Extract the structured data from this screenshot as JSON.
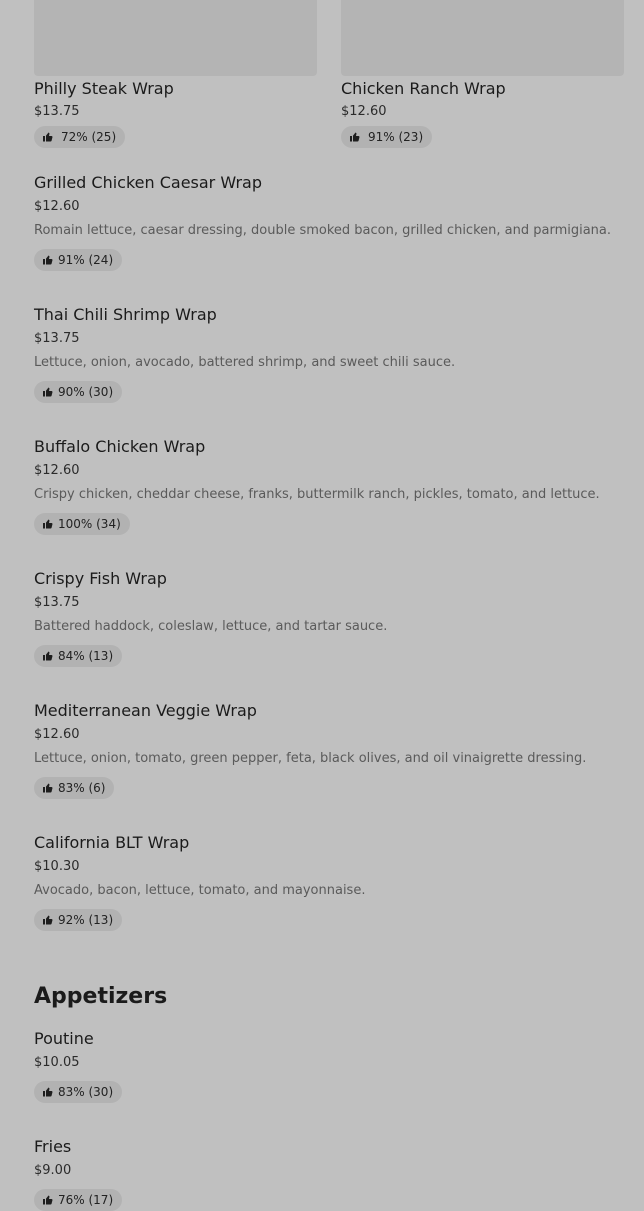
{
  "top_grid": [
    {
      "name": "Philly Steak Wrap",
      "price": "$13.75",
      "rating": "72% (25)"
    },
    {
      "name": "Chicken Ranch Wrap",
      "price": "$12.60",
      "rating": "91% (23)"
    }
  ],
  "wraps": [
    {
      "name": "Grilled Chicken Caesar Wrap",
      "price": "$12.60",
      "description": "Romain lettuce, caesar dressing, double smoked bacon, grilled chicken, and parmigiana.",
      "rating": "91% (24)"
    },
    {
      "name": "Thai Chili Shrimp Wrap",
      "price": "$13.75",
      "description": "Lettuce, onion, avocado, battered shrimp, and sweet chili sauce.",
      "rating": "90% (30)"
    },
    {
      "name": "Buffalo Chicken Wrap",
      "price": "$12.60",
      "description": "Crispy chicken, cheddar cheese, franks, buttermilk ranch, pickles, tomato, and lettuce.",
      "rating": "100% (34)"
    },
    {
      "name": "Crispy Fish Wrap",
      "price": "$13.75",
      "description": "Battered haddock, coleslaw, lettuce, and tartar sauce.",
      "rating": "84% (13)"
    },
    {
      "name": "Mediterranean Veggie Wrap",
      "price": "$12.60",
      "description": "Lettuce, onion, tomato, green pepper, feta, black olives, and oil vinaigrette dressing.",
      "rating": "83% (6)"
    },
    {
      "name": "California BLT Wrap",
      "price": "$10.30",
      "description": "Avocado, bacon, lettuce, tomato, and mayonnaise.",
      "rating": "92% (13)"
    }
  ],
  "appetizers_section": {
    "title": "Appetizers",
    "items": [
      {
        "name": "Poutine",
        "price": "$10.05",
        "rating": "83% (30)"
      },
      {
        "name": "Fries",
        "price": "$9.00",
        "rating": "76% (17)"
      }
    ]
  },
  "icons": {
    "rating": "thumbs-up-icon"
  },
  "colors": {
    "overlay_background": "#c0c0c0",
    "badge_background": "#b2b2b2",
    "image_placeholder": "#b4b4b4"
  }
}
